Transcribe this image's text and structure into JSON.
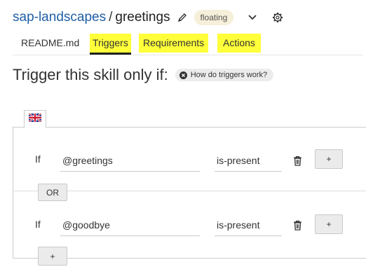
{
  "header": {
    "project": "sap-landscapes",
    "separator": "/",
    "skill": "greetings",
    "status_badge": "floating"
  },
  "tabs": [
    {
      "label": "README.md",
      "highlighted": false,
      "active": false
    },
    {
      "label": "Triggers",
      "highlighted": true,
      "active": true
    },
    {
      "label": "Requirements",
      "highlighted": true,
      "active": false
    },
    {
      "label": "Actions",
      "highlighted": true,
      "active": false
    }
  ],
  "highlight_color": "#ffff3a",
  "title": "Trigger this skill only if:",
  "help_link": "How do triggers work?",
  "language_flag": "uk-flag",
  "conditions": [
    {
      "if_label": "If",
      "entity": "@greetings",
      "operator": "is-present",
      "add_label": "+"
    },
    {
      "if_label": "If",
      "entity": "@goodbye",
      "operator": "is-present",
      "add_label": "+"
    }
  ],
  "or_label": "OR",
  "add_group_label": "+"
}
